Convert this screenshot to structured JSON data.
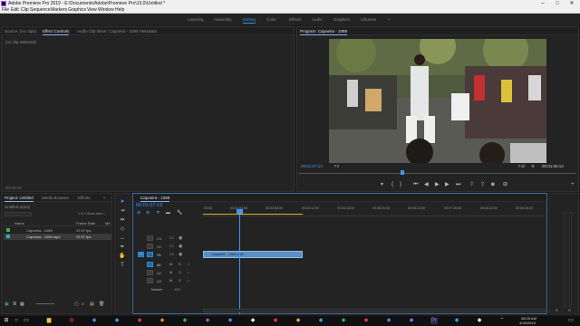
{
  "titlebar": {
    "title": "Adobe Premiere Pro 2019 - E:\\Documents\\Adobe\\Premiere Pro\\13.0\\Untitled *",
    "min": "–",
    "max": "□",
    "close": "✕"
  },
  "menu": [
    "File",
    "Edit",
    "Clip",
    "Sequence",
    "Markers",
    "Graphics",
    "View",
    "Window",
    "Help"
  ],
  "workspaces": [
    "Learning",
    "Assembly",
    "Editing",
    "Color",
    "Effects",
    "Audio",
    "Graphics",
    "Libraries"
  ],
  "active_workspace": "Editing",
  "source_panel": {
    "tabs": [
      "Source: (no clips)",
      "Effect Controls",
      "Audio Clip Mixer: Capoeira - 1089",
      "Metadata"
    ],
    "selected_tab": "Effect Controls",
    "empty_text": "(no clip selected)",
    "timecode": "00:00:00"
  },
  "program": {
    "title": "Program: Capoeira - 1089",
    "timecode": "00:01:07:13",
    "fit": "Fit",
    "quality": "Full",
    "duration": "00:01:59:14"
  },
  "project": {
    "tabs": [
      "Project: Untitled",
      "Media Browser",
      "Effects"
    ],
    "name": "Untitled.prproj",
    "count": "1 of 2 items selec...",
    "columns": [
      "Name",
      "Frame Rate",
      "Me"
    ],
    "items": [
      {
        "name": "Capoeira - 1089",
        "rate": "29.97 fps"
      },
      {
        "name": "Capoeira - 1089.mp4",
        "rate": "29.97 fps"
      }
    ]
  },
  "timeline": {
    "tab": "Capoeira - 1089",
    "timecode": "00:01:07:13",
    "ruler": [
      "00:00",
      "00:01:04:00",
      "00:02:08:00",
      "00:03:12:00",
      "00:04:16:00",
      "00:05:20:00",
      "00:06:24:00",
      "00:07:28:00",
      "00:08:32:00",
      "00:09:36:00"
    ],
    "video_tracks": [
      "V3",
      "V2",
      "V1"
    ],
    "audio_tracks": [
      "A1",
      "A2",
      "A3"
    ],
    "master": "Master",
    "master_val": "0.0",
    "clip_label": "Capoeira - 1089.mp4"
  },
  "clock": {
    "time": "08:25 AM",
    "date": "4/26/2019"
  },
  "colors": {
    "accent": "#3b8ff0",
    "clip": "#5a8fc4",
    "playhead": "#3e98ff"
  }
}
